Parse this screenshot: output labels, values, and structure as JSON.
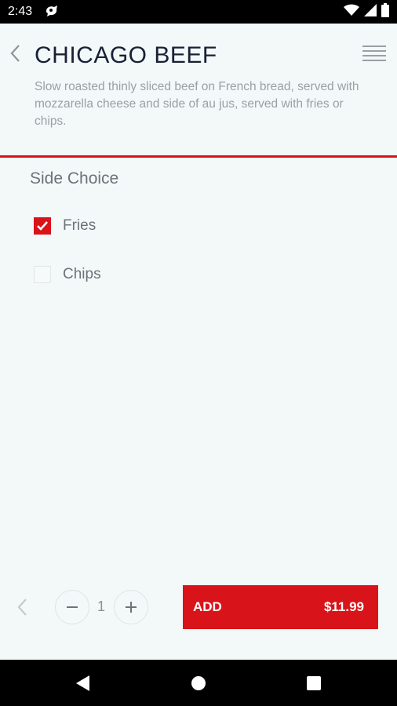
{
  "status_bar": {
    "time": "2:43"
  },
  "header": {
    "title": "CHICAGO BEEF",
    "description": "Slow roasted thinly sliced beef on French bread, served with mozzarella cheese and side of au jus, served with fries or chips."
  },
  "side_choice": {
    "title": "Side Choice",
    "options": [
      {
        "label": "Fries",
        "checked": true
      },
      {
        "label": "Chips",
        "checked": false
      }
    ]
  },
  "order": {
    "quantity": "1",
    "add_label": "ADD",
    "price": "$11.99"
  },
  "colors": {
    "accent": "#d9131a",
    "background": "#f3f9f9",
    "title": "#1a2035"
  }
}
